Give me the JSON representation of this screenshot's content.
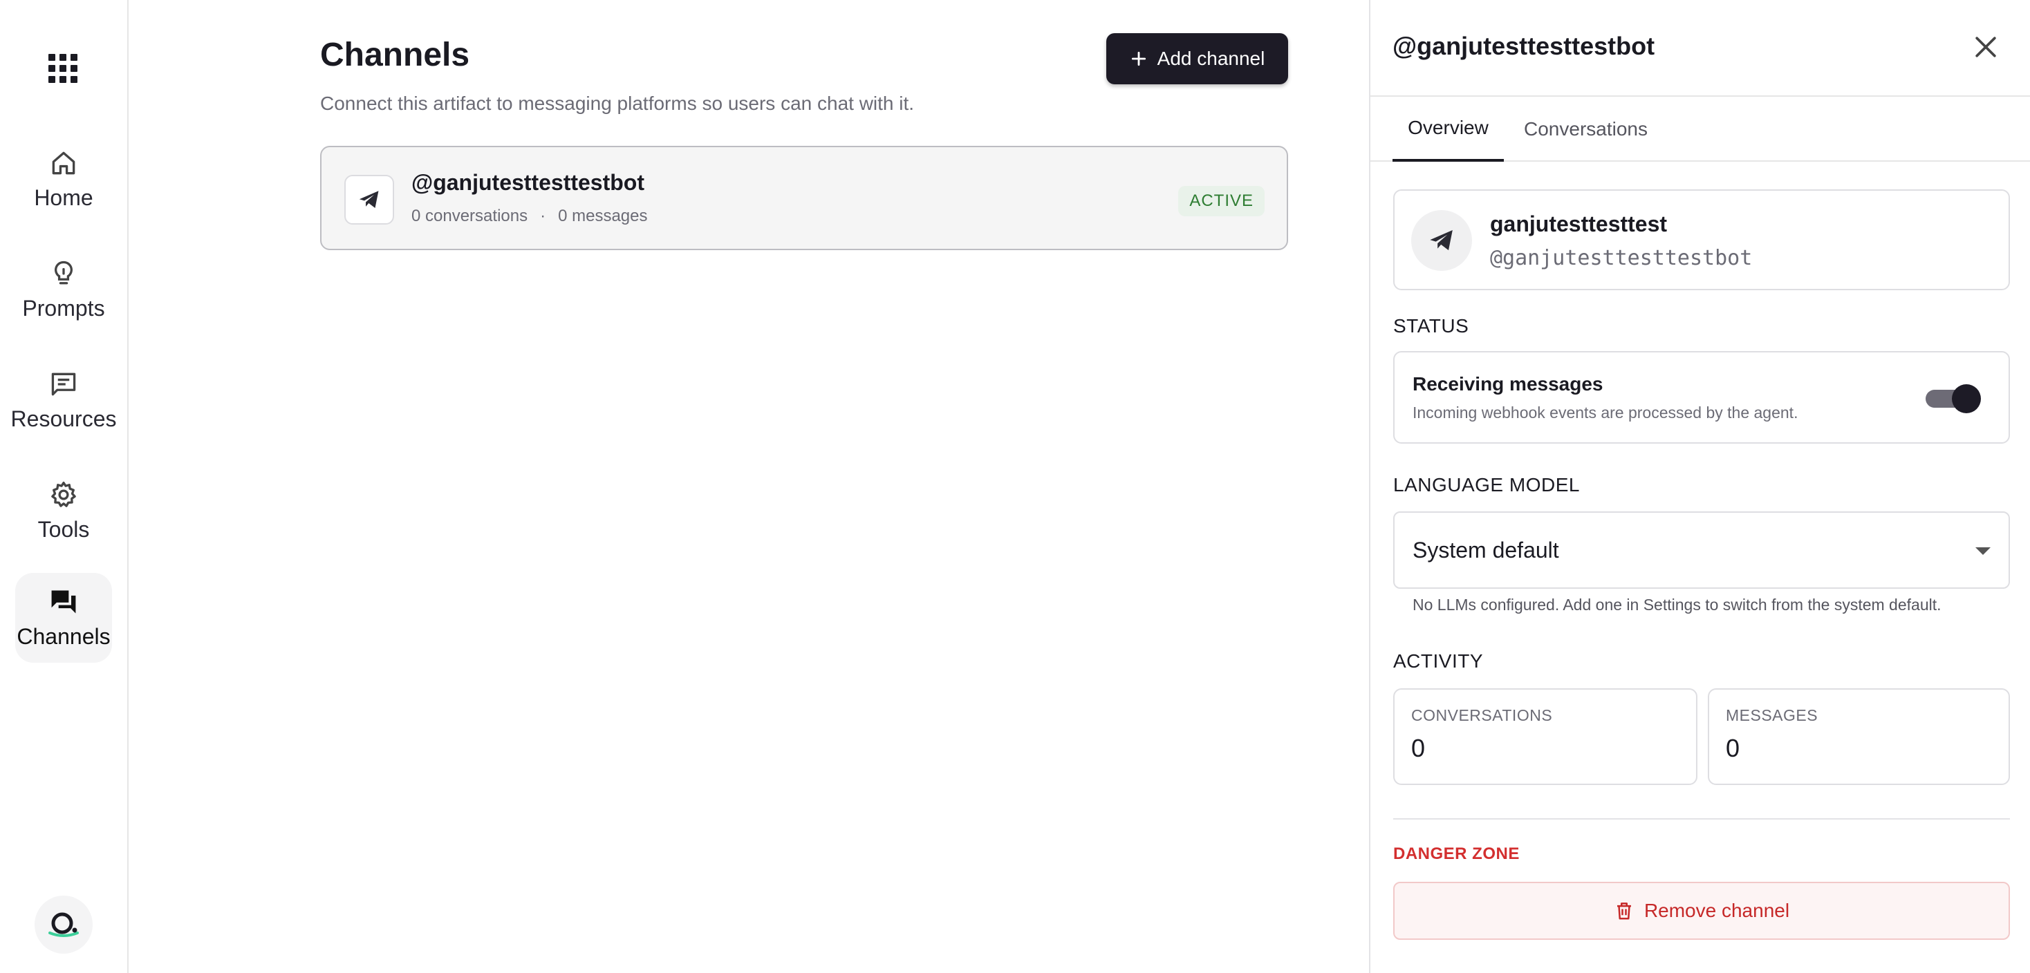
{
  "colors": {
    "primary_dark": "#1d1b26",
    "accent_green": "#2e7d32",
    "danger_red": "#d32f2f",
    "muted_text": "#6b6b75"
  },
  "sidebar": {
    "apps_icon": "grid-icon",
    "items": [
      {
        "label": "Home",
        "icon": "home-icon",
        "active": false
      },
      {
        "label": "Prompts",
        "icon": "lightbulb-icon",
        "active": false
      },
      {
        "label": "Resources",
        "icon": "message-square-icon",
        "active": false
      },
      {
        "label": "Tools",
        "icon": "gear-icon",
        "active": false
      },
      {
        "label": "Channels",
        "icon": "forum-icon",
        "active": true
      }
    ],
    "logo_icon": "logo-icon"
  },
  "main": {
    "title": "Channels",
    "subtitle": "Connect this artifact to messaging platforms so users can chat with it.",
    "add_button_label": "Add channel",
    "channels": [
      {
        "name": "@ganjutesttesttestbot",
        "conversations": "0 conversations",
        "separator": "·",
        "messages": "0 messages",
        "status": "ACTIVE",
        "icon": "telegram-icon"
      }
    ]
  },
  "panel": {
    "title": "@ganjutesttesttestbot",
    "close_icon": "close-icon",
    "tabs": [
      {
        "label": "Overview",
        "active": true
      },
      {
        "label": "Conversations",
        "active": false
      }
    ],
    "bot": {
      "display_name": "ganjutesttesttest",
      "handle": "@ganjutesttesttestbot"
    },
    "status": {
      "section_label": "STATUS",
      "title": "Receiving messages",
      "description": "Incoming webhook events are processed by the agent.",
      "enabled": true
    },
    "language_model": {
      "section_label": "LANGUAGE MODEL",
      "selected": "System default",
      "hint": "No LLMs configured. Add one in Settings to switch from the system default."
    },
    "activity": {
      "section_label": "ACTIVITY",
      "conversations_label": "CONVERSATIONS",
      "conversations_value": "0",
      "messages_label": "MESSAGES",
      "messages_value": "0"
    },
    "danger": {
      "section_label": "DANGER ZONE",
      "remove_label": "Remove channel"
    }
  }
}
